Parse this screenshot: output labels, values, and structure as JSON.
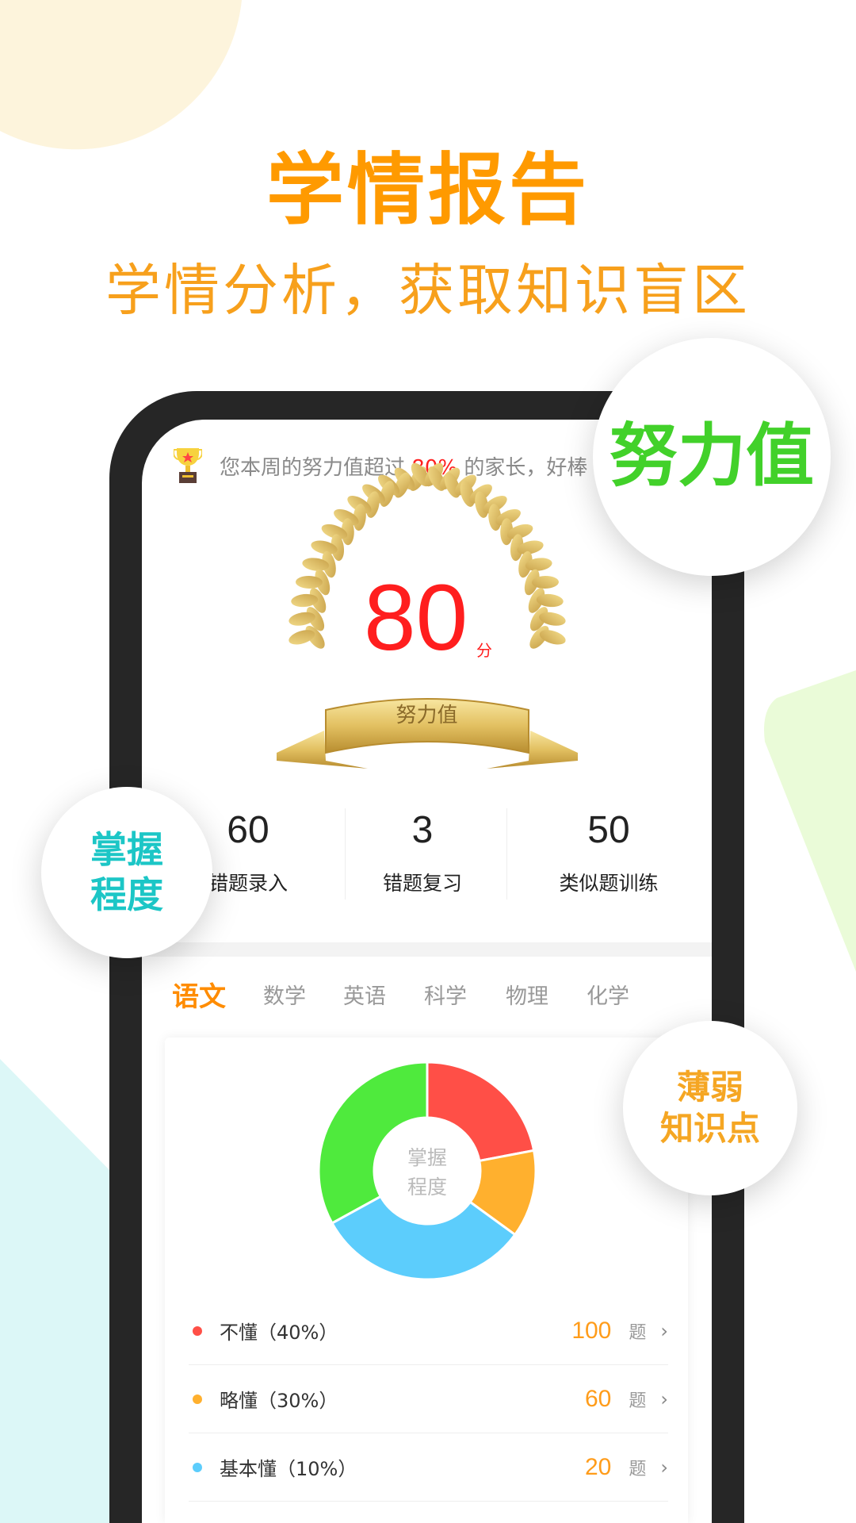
{
  "header": {
    "title": "学情报告",
    "subtitle": "学情分析，获取知识盲区"
  },
  "notice": {
    "prefix": "您本周的努力值超过",
    "highlight": "80%",
    "suffix": "的家长，好棒",
    "icon": "trophy-icon"
  },
  "score": {
    "value": "80",
    "unit": "分",
    "ribbon_label": "努力值"
  },
  "stats": [
    {
      "value": "60",
      "label": "错题录入"
    },
    {
      "value": "3",
      "label": "错题复习"
    },
    {
      "value": "50",
      "label": "类似题训练"
    }
  ],
  "tabs": [
    {
      "label": "语文",
      "active": true
    },
    {
      "label": "数学"
    },
    {
      "label": "英语"
    },
    {
      "label": "科学"
    },
    {
      "label": "物理"
    },
    {
      "label": "化学"
    }
  ],
  "donut": {
    "center_line1": "掌握",
    "center_line2": "程度",
    "segments": [
      {
        "value": 22,
        "color": "#ff4f47"
      },
      {
        "value": 13,
        "color": "#ffb02e"
      },
      {
        "value": 32,
        "color": "#5ccdfc"
      },
      {
        "value": 33,
        "color": "#4fea3d"
      }
    ]
  },
  "legend": [
    {
      "label": "不懂（40%）",
      "count": "100",
      "unit": "题",
      "color": "#ff4f47"
    },
    {
      "label": "略懂（30%）",
      "count": "60",
      "unit": "题",
      "color": "#ffb02e"
    },
    {
      "label": "基本懂（10%）",
      "count": "20",
      "unit": "题",
      "color": "#5ccdfc"
    }
  ],
  "bubbles": {
    "effort": "努力值",
    "mastery_1": "掌握",
    "mastery_2": "程度",
    "weak_1": "薄弱",
    "weak_2": "知识点"
  },
  "colors": {
    "accent": "#ff9a00",
    "effort_green": "#42d12a",
    "mastery_teal": "#1cc6c6",
    "weak_orange": "#f5a623",
    "score_red": "#ff1e1e"
  }
}
